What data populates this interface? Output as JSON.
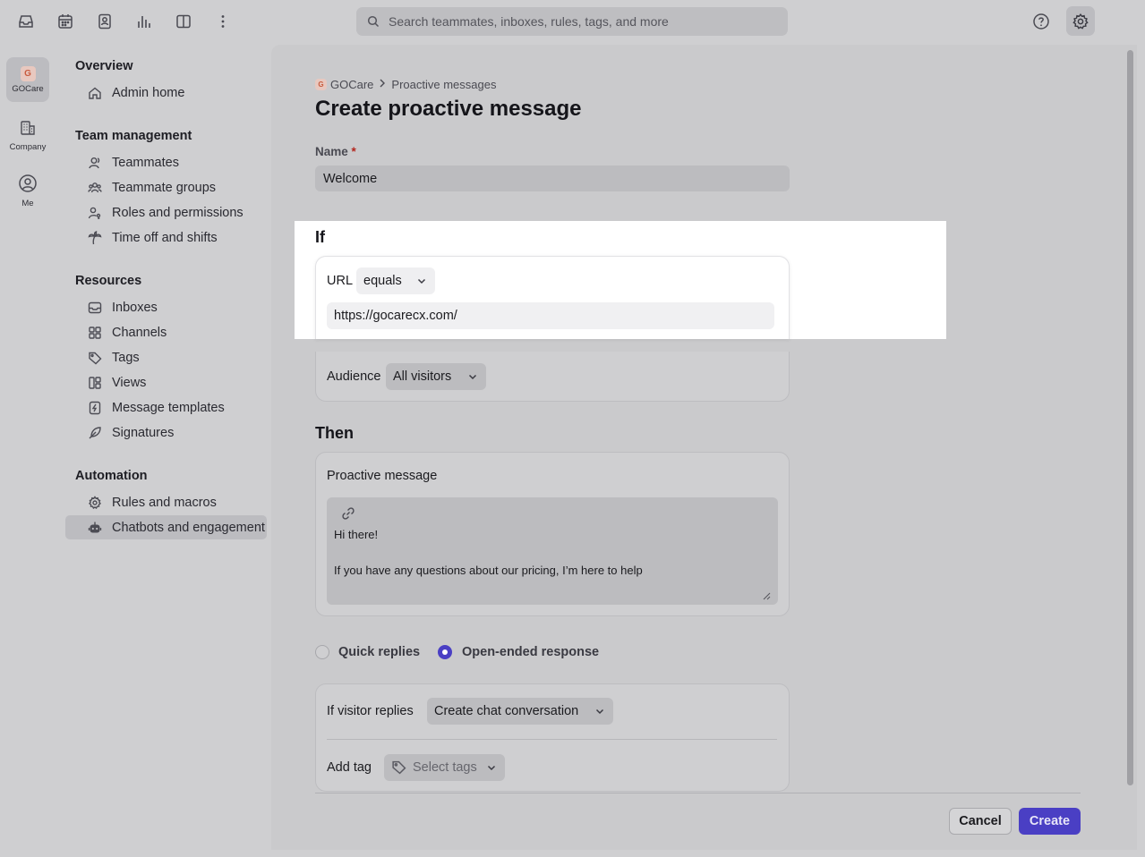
{
  "search": {
    "placeholder": "Search teammates, inboxes, rules, tags, and more"
  },
  "rail": {
    "items": [
      {
        "label": "GOCare",
        "logo_letter": "G"
      },
      {
        "label": "Company"
      },
      {
        "label": "Me"
      }
    ]
  },
  "sidebar": {
    "sections": [
      {
        "title": "Overview",
        "items": [
          "Admin home"
        ]
      },
      {
        "title": "Team management",
        "items": [
          "Teammates",
          "Teammate groups",
          "Roles and permissions",
          "Time off and shifts"
        ]
      },
      {
        "title": "Resources",
        "items": [
          "Inboxes",
          "Channels",
          "Tags",
          "Views",
          "Message templates",
          "Signatures"
        ]
      },
      {
        "title": "Automation",
        "items": [
          "Rules and macros",
          "Chatbots and engagement"
        ]
      }
    ],
    "active_item": "Chatbots and engagement"
  },
  "breadcrumb": {
    "logo_letter": "G",
    "root": "GOCare",
    "current": "Proactive messages"
  },
  "page": {
    "title": "Create proactive message"
  },
  "form": {
    "name_label": "Name",
    "name_required": "*",
    "name_value": "Welcome",
    "if_title": "If",
    "url_label": "URL",
    "url_operator": "equals",
    "url_value": "https://gocarecx.com/",
    "audience_label": "Audience",
    "audience_value": "All visitors",
    "then_title": "Then",
    "message_label": "Proactive message",
    "message_line1": "Hi there!",
    "message_line2": "If you have any questions about our pricing, I’m here to help",
    "radio_quick": "Quick replies",
    "radio_open": "Open-ended response",
    "radio_selected": "Open-ended response",
    "visitor_replies_label": "If visitor replies",
    "visitor_replies_value": "Create chat conversation",
    "add_tag_label": "Add tag",
    "tags_placeholder": "Select tags"
  },
  "footer": {
    "cancel": "Cancel",
    "create": "Create"
  },
  "colors": {
    "accent": "#4a3fc4",
    "required": "#b3261e",
    "logo_bg": "#e8c8bf",
    "logo_fg": "#c85b3e"
  }
}
